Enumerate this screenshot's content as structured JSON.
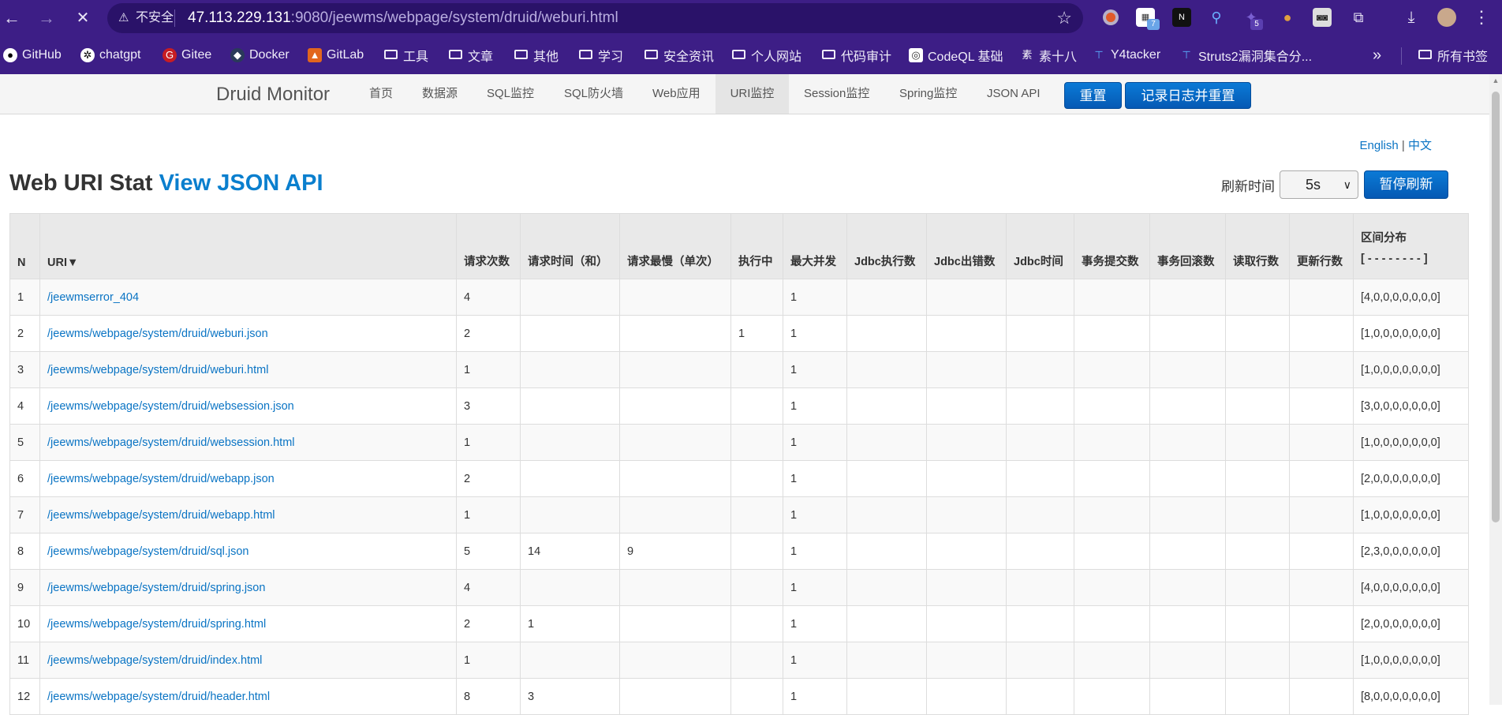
{
  "browser": {
    "insecure_label": "不安全",
    "url_host": "47.113.229.131",
    "url_rest": ":9080/jeewms/webpage/system/druid/weburi.html",
    "back_icon": "←",
    "forward_icon": "→",
    "reload_icon": "✕",
    "warn_icon": "⚠",
    "star_icon": "☆",
    "menu_icon": "⋮",
    "download_icon": "⤓",
    "ext_badge_1": "7",
    "ext_badge_2": "5",
    "bookmarks": [
      "GitHub",
      "chatgpt",
      "Gitee",
      "Docker",
      "GitLab",
      "工具",
      "文章",
      "其他",
      "学习",
      "安全资讯",
      "个人网站",
      "代码审计",
      "CodeQL 基础",
      "素十八",
      "Y4tacker",
      "Struts2漏洞集合分..."
    ],
    "more_bookmarks": "»",
    "all_bookmarks": "所有书签"
  },
  "druid": {
    "brand": "Druid Monitor",
    "nav": [
      "首页",
      "数据源",
      "SQL监控",
      "SQL防火墙",
      "Web应用",
      "URI监控",
      "Session监控",
      "Spring监控",
      "JSON API"
    ],
    "reset_button": "重置",
    "log_reset_button": "记录日志并重置"
  },
  "page": {
    "lang_en": "English",
    "lang_sep": "|",
    "lang_zh": "中文",
    "title": "Web URI Stat",
    "title_link": "View JSON API",
    "refresh_label": "刷新时间",
    "refresh_value": "5s",
    "pause_button": "暂停刷新"
  },
  "table": {
    "headers": [
      "N",
      "URI▼",
      "请求次数",
      "请求时间（和）",
      "请求最慢（单次）",
      "执行中",
      "最大并发",
      "Jdbc执行数",
      "Jdbc出错数",
      "Jdbc时间",
      "事务提交数",
      "事务回滚数",
      "读取行数",
      "更新行数",
      "区间分布"
    ],
    "dist_sub": "[ - - - - - - - - ]",
    "rows": [
      [
        "1",
        "/jeewmserror_404",
        "4",
        "",
        "",
        "",
        "1",
        "",
        "",
        "",
        "",
        "",
        "",
        "",
        "[4,0,0,0,0,0,0,0]"
      ],
      [
        "2",
        "/jeewms/webpage/system/druid/weburi.json",
        "2",
        "",
        "",
        "1",
        "1",
        "",
        "",
        "",
        "",
        "",
        "",
        "",
        "[1,0,0,0,0,0,0,0]"
      ],
      [
        "3",
        "/jeewms/webpage/system/druid/weburi.html",
        "1",
        "",
        "",
        "",
        "1",
        "",
        "",
        "",
        "",
        "",
        "",
        "",
        "[1,0,0,0,0,0,0,0]"
      ],
      [
        "4",
        "/jeewms/webpage/system/druid/websession.json",
        "3",
        "",
        "",
        "",
        "1",
        "",
        "",
        "",
        "",
        "",
        "",
        "",
        "[3,0,0,0,0,0,0,0]"
      ],
      [
        "5",
        "/jeewms/webpage/system/druid/websession.html",
        "1",
        "",
        "",
        "",
        "1",
        "",
        "",
        "",
        "",
        "",
        "",
        "",
        "[1,0,0,0,0,0,0,0]"
      ],
      [
        "6",
        "/jeewms/webpage/system/druid/webapp.json",
        "2",
        "",
        "",
        "",
        "1",
        "",
        "",
        "",
        "",
        "",
        "",
        "",
        "[2,0,0,0,0,0,0,0]"
      ],
      [
        "7",
        "/jeewms/webpage/system/druid/webapp.html",
        "1",
        "",
        "",
        "",
        "1",
        "",
        "",
        "",
        "",
        "",
        "",
        "",
        "[1,0,0,0,0,0,0,0]"
      ],
      [
        "8",
        "/jeewms/webpage/system/druid/sql.json",
        "5",
        "14",
        "9",
        "",
        "1",
        "",
        "",
        "",
        "",
        "",
        "",
        "",
        "[2,3,0,0,0,0,0,0]"
      ],
      [
        "9",
        "/jeewms/webpage/system/druid/spring.json",
        "4",
        "",
        "",
        "",
        "1",
        "",
        "",
        "",
        "",
        "",
        "",
        "",
        "[4,0,0,0,0,0,0,0]"
      ],
      [
        "10",
        "/jeewms/webpage/system/druid/spring.html",
        "2",
        "1",
        "",
        "",
        "1",
        "",
        "",
        "",
        "",
        "",
        "",
        "",
        "[2,0,0,0,0,0,0,0]"
      ],
      [
        "11",
        "/jeewms/webpage/system/druid/index.html",
        "1",
        "",
        "",
        "",
        "1",
        "",
        "",
        "",
        "",
        "",
        "",
        "",
        "[1,0,0,0,0,0,0,0]"
      ],
      [
        "12",
        "/jeewms/webpage/system/druid/header.html",
        "8",
        "3",
        "",
        "",
        "1",
        "",
        "",
        "",
        "",
        "",
        "",
        "",
        "[8,0,0,0,0,0,0,0]"
      ]
    ]
  }
}
